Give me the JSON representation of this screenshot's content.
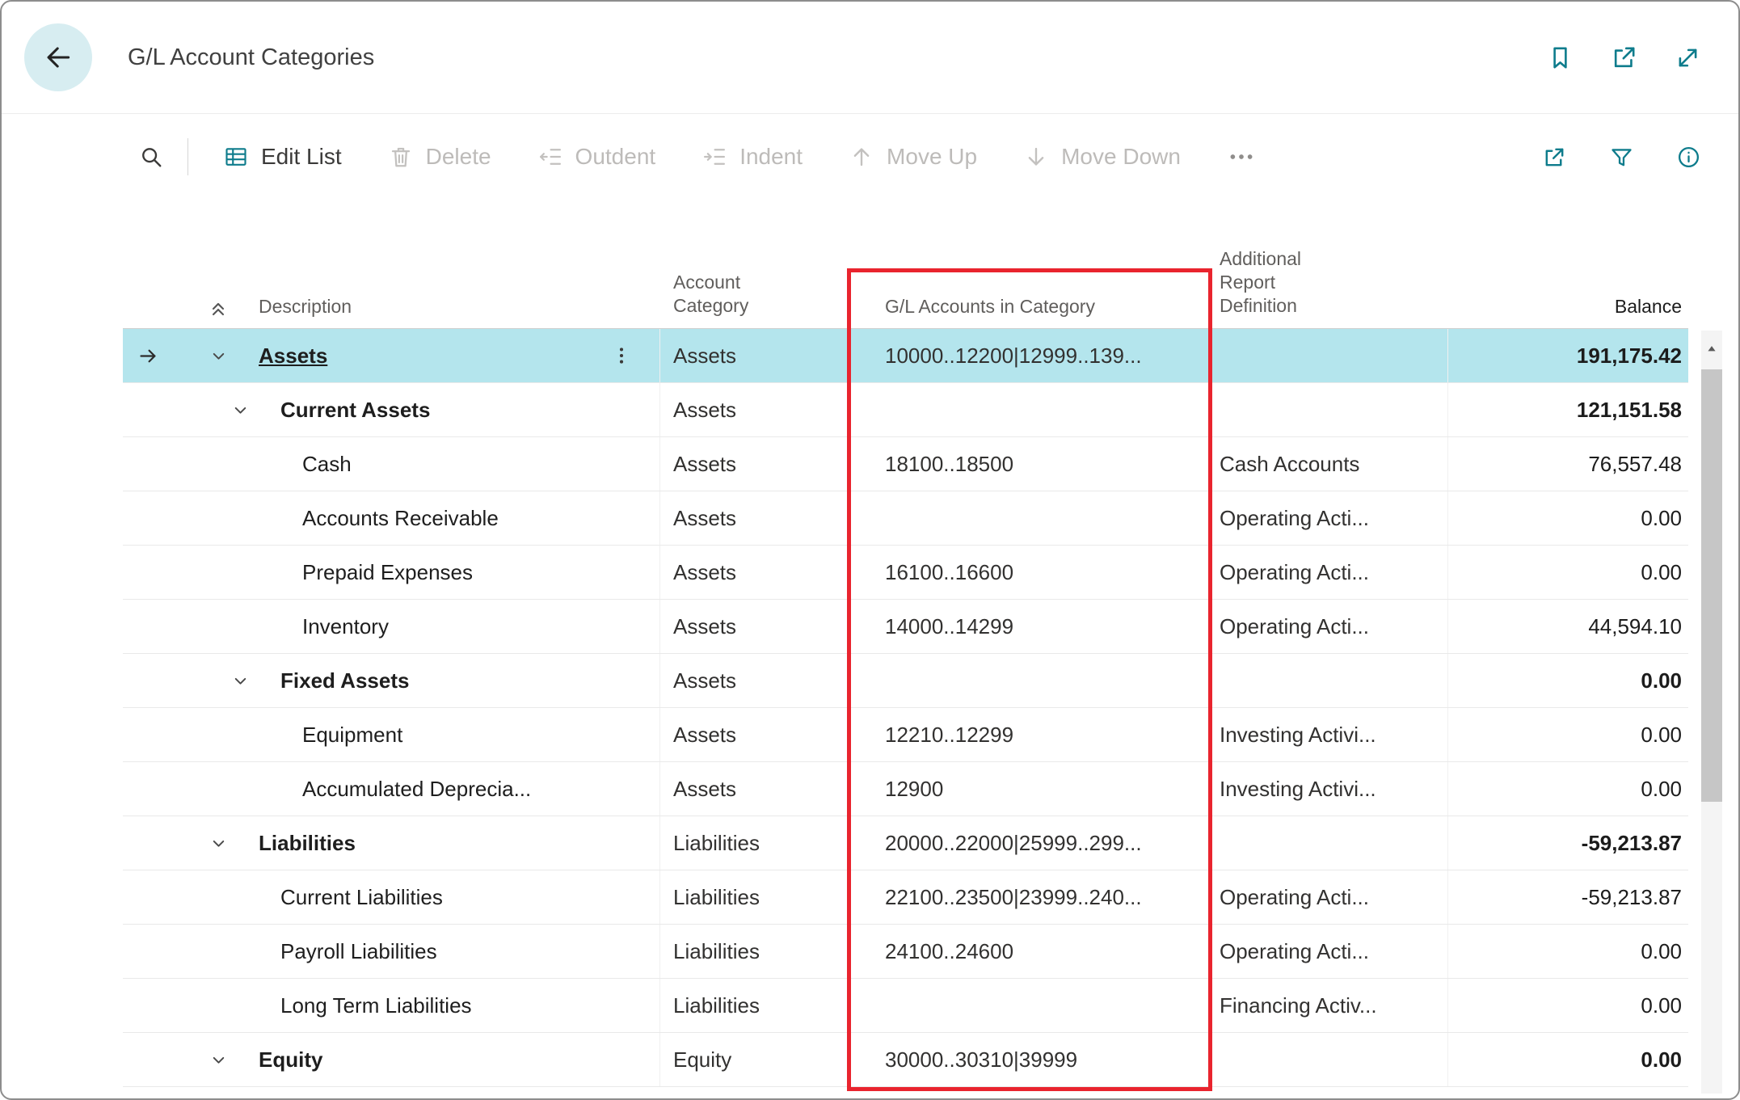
{
  "page": {
    "title": "G/L Account Categories"
  },
  "icons": {
    "back": "arrow-left",
    "header_actions": [
      "bookmark",
      "open-in-new-window",
      "resize-diagonal"
    ],
    "toolbar_left": "search",
    "toolbar_right": [
      "share",
      "filter",
      "info"
    ],
    "collapse_all": "double-chevron-up",
    "row_expand": "chevron-down",
    "row_options": "vertical-ellipsis",
    "current_row_indicator": "arrow-right",
    "scrollbar": "triangle-up"
  },
  "toolbar": {
    "items": [
      {
        "label": "Edit List",
        "enabled": true
      },
      {
        "label": "Delete",
        "enabled": false
      },
      {
        "label": "Outdent",
        "enabled": false
      },
      {
        "label": "Indent",
        "enabled": false
      },
      {
        "label": "Move Up",
        "enabled": false
      },
      {
        "label": "Move Down",
        "enabled": false
      }
    ]
  },
  "table": {
    "columns": {
      "description": "Description",
      "account_category": "Account Category",
      "gl_accounts": "G/L Accounts in Category",
      "additional_report_definition": "Additional Report Definition",
      "balance": "Balance"
    },
    "rows": [
      {
        "description": "Assets",
        "account_category": "Assets",
        "gl_accounts": "10000..12200|12999..139...",
        "additional_report_definition": "",
        "balance": "191,175.42",
        "indent": 0,
        "bold": true,
        "selected": true
      },
      {
        "description": "Current Assets",
        "account_category": "Assets",
        "gl_accounts": "",
        "additional_report_definition": "",
        "balance": "121,151.58",
        "indent": 1,
        "bold": true
      },
      {
        "description": "Cash",
        "account_category": "Assets",
        "gl_accounts": "18100..18500",
        "additional_report_definition": "Cash Accounts",
        "balance": "76,557.48",
        "indent": 2
      },
      {
        "description": "Accounts Receivable",
        "account_category": "Assets",
        "gl_accounts": "",
        "additional_report_definition": "Operating Acti...",
        "balance": "0.00",
        "indent": 2
      },
      {
        "description": "Prepaid Expenses",
        "account_category": "Assets",
        "gl_accounts": "16100..16600",
        "additional_report_definition": "Operating Acti...",
        "balance": "0.00",
        "indent": 2
      },
      {
        "description": "Inventory",
        "account_category": "Assets",
        "gl_accounts": "14000..14299",
        "additional_report_definition": "Operating Acti...",
        "balance": "44,594.10",
        "indent": 2
      },
      {
        "description": "Fixed Assets",
        "account_category": "Assets",
        "gl_accounts": "",
        "additional_report_definition": "",
        "balance": "0.00",
        "indent": 1,
        "bold": true
      },
      {
        "description": "Equipment",
        "account_category": "Assets",
        "gl_accounts": "12210..12299",
        "additional_report_definition": "Investing Activi...",
        "balance": "0.00",
        "indent": 2
      },
      {
        "description": "Accumulated Deprecia...",
        "account_category": "Assets",
        "gl_accounts": "12900",
        "additional_report_definition": "Investing Activi...",
        "balance": "0.00",
        "indent": 2
      },
      {
        "description": "Liabilities",
        "account_category": "Liabilities",
        "gl_accounts": "20000..22000|25999..299...",
        "additional_report_definition": "",
        "balance": "-59,213.87",
        "indent": 0,
        "bold": true
      },
      {
        "description": "Current Liabilities",
        "account_category": "Liabilities",
        "gl_accounts": "22100..23500|23999..240...",
        "additional_report_definition": "Operating Acti...",
        "balance": "-59,213.87",
        "indent": 1
      },
      {
        "description": "Payroll Liabilities",
        "account_category": "Liabilities",
        "gl_accounts": "24100..24600",
        "additional_report_definition": "Operating Acti...",
        "balance": "0.00",
        "indent": 1
      },
      {
        "description": "Long Term Liabilities",
        "account_category": "Liabilities",
        "gl_accounts": "",
        "additional_report_definition": "Financing Activ...",
        "balance": "0.00",
        "indent": 1
      },
      {
        "description": "Equity",
        "account_category": "Equity",
        "gl_accounts": "30000..30310|39999",
        "additional_report_definition": "",
        "balance": "0.00",
        "indent": 0,
        "bold": true
      }
    ]
  },
  "colors": {
    "accent": "#0e7c8c",
    "selected_row": "#b4e5ed",
    "annotation_red": "#e9242e"
  }
}
